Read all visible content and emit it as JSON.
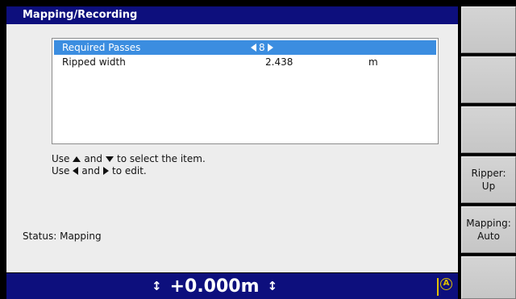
{
  "window": {
    "title": "Mapping/Recording"
  },
  "list": {
    "rows": [
      {
        "label": "Required Passes",
        "value": "8",
        "unit": "",
        "selected": true
      },
      {
        "label": "Ripped width",
        "value": "2.438",
        "unit": "m",
        "selected": false
      }
    ]
  },
  "help": {
    "line1_pre": "Use",
    "line1_mid": "and",
    "line1_post": "to select the item.",
    "line2_pre": "Use",
    "line2_mid": "and",
    "line2_post": "to edit."
  },
  "status": {
    "text": "Status: Mapping"
  },
  "statusbar": {
    "elevation": "+0.000m",
    "gps_icon": "gps-a-icon"
  },
  "softkeys": [
    {
      "line1": "",
      "line2": ""
    },
    {
      "line1": "",
      "line2": ""
    },
    {
      "line1": "",
      "line2": ""
    },
    {
      "line1": "Ripper:",
      "line2": "Up"
    },
    {
      "line1": "Mapping:",
      "line2": "Auto"
    },
    {
      "line1": "",
      "line2": ""
    }
  ],
  "colors": {
    "title_bar": "#0d0f7d",
    "selection": "#3b8de0",
    "panel": "#ededed",
    "gps_indicator": "#e0c000"
  }
}
